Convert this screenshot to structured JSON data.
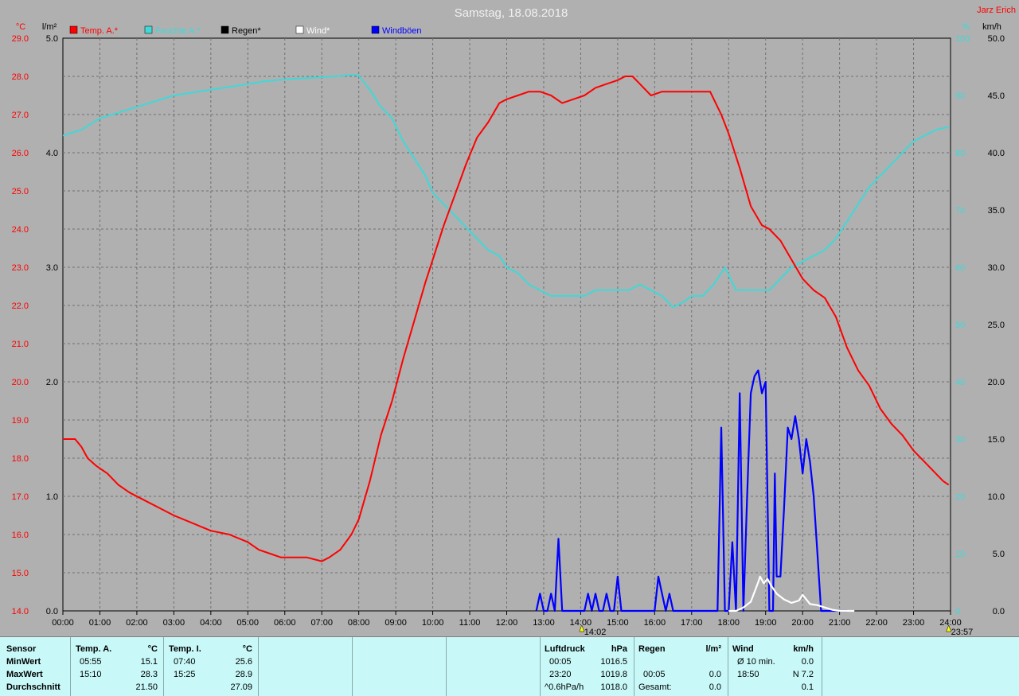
{
  "title": "Samstag, 18.08.2018",
  "author": "Jarz Erich",
  "colors": {
    "background": "#b0b0b0",
    "temp": "#ff0000",
    "humidity": "#40d8d8",
    "rain": "#000000",
    "wind": "#ffffff",
    "gusts": "#0000ff",
    "panel": "#c8f8f8"
  },
  "chart_data": {
    "type": "line",
    "axes": {
      "left_temp": {
        "unit": "°C",
        "range": [
          14.0,
          29.0
        ],
        "ticks": [
          "14.0",
          "15.0",
          "16.0",
          "17.0",
          "18.0",
          "19.0",
          "20.0",
          "21.0",
          "22.0",
          "23.0",
          "24.0",
          "25.0",
          "26.0",
          "27.0",
          "28.0",
          "29.0"
        ]
      },
      "left_rain": {
        "unit": "l/m²",
        "range": [
          0.0,
          5.0
        ],
        "ticks": [
          "0.0",
          "1.0",
          "2.0",
          "3.0",
          "4.0",
          "5.0"
        ]
      },
      "right_humidity": {
        "unit": "%",
        "range": [
          0,
          100
        ],
        "ticks": [
          "0",
          "10",
          "20",
          "30",
          "40",
          "50",
          "60",
          "70",
          "80",
          "90",
          "100"
        ]
      },
      "right_wind": {
        "unit": "km/h",
        "range": [
          0.0,
          50.0
        ],
        "ticks": [
          "0.0",
          "5.0",
          "10.0",
          "15.0",
          "20.0",
          "25.0",
          "30.0",
          "35.0",
          "40.0",
          "45.0",
          "50.0"
        ]
      },
      "x": {
        "range": [
          0,
          24
        ],
        "ticks": [
          "00:00",
          "01:00",
          "02:00",
          "03:00",
          "04:00",
          "05:00",
          "06:00",
          "07:00",
          "08:00",
          "09:00",
          "10:00",
          "11:00",
          "12:00",
          "13:00",
          "14:00",
          "15:00",
          "16:00",
          "17:00",
          "18:00",
          "19:00",
          "20:00",
          "21:00",
          "22:00",
          "23:00",
          "24:00"
        ]
      }
    },
    "grid": true,
    "legend_position": "top-left",
    "markers": [
      {
        "label": "14:02",
        "x": 14.03
      },
      {
        "label": "23:57",
        "x": 23.95
      }
    ],
    "series": [
      {
        "name": "Temp. A.*",
        "axis": "left_temp",
        "color": "#ff0000",
        "x": [
          0,
          0.33,
          0.5,
          0.67,
          0.9,
          1.2,
          1.5,
          1.8,
          2.2,
          2.6,
          3,
          3.5,
          4,
          4.5,
          5,
          5.3,
          5.6,
          5.9,
          6.2,
          6.6,
          7,
          7.2,
          7.5,
          7.8,
          8,
          8.3,
          8.6,
          8.9,
          9.2,
          9.5,
          9.8,
          10,
          10.3,
          10.6,
          10.9,
          11.2,
          11.5,
          11.8,
          12,
          12.3,
          12.6,
          12.9,
          13.2,
          13.5,
          13.8,
          14.1,
          14.4,
          14.7,
          15,
          15.2,
          15.4,
          15.6,
          15.9,
          16.2,
          16.5,
          16.8,
          17,
          17.2,
          17.5,
          17.8,
          18,
          18.3,
          18.6,
          18.9,
          19.1,
          19.4,
          19.7,
          20,
          20.3,
          20.6,
          20.9,
          21.2,
          21.5,
          21.8,
          22.1,
          22.4,
          22.7,
          23,
          23.3,
          23.6,
          23.8,
          23.95
        ],
        "y": [
          18.5,
          18.5,
          18.3,
          18.0,
          17.8,
          17.6,
          17.3,
          17.1,
          16.9,
          16.7,
          16.5,
          16.3,
          16.1,
          16.0,
          15.8,
          15.6,
          15.5,
          15.4,
          15.4,
          15.4,
          15.3,
          15.4,
          15.6,
          16.0,
          16.4,
          17.4,
          18.6,
          19.5,
          20.6,
          21.6,
          22.6,
          23.2,
          24.1,
          24.9,
          25.7,
          26.4,
          26.8,
          27.3,
          27.4,
          27.5,
          27.6,
          27.6,
          27.5,
          27.3,
          27.4,
          27.5,
          27.7,
          27.8,
          27.9,
          28.0,
          28.0,
          27.8,
          27.5,
          27.6,
          27.6,
          27.6,
          27.6,
          27.6,
          27.6,
          27.0,
          26.5,
          25.6,
          24.6,
          24.1,
          24.0,
          23.7,
          23.2,
          22.7,
          22.4,
          22.2,
          21.7,
          20.9,
          20.3,
          19.9,
          19.3,
          18.9,
          18.6,
          18.2,
          17.9,
          17.6,
          17.4,
          17.3
        ]
      },
      {
        "name": "Feuchte A.*",
        "axis": "right_humidity",
        "color": "#40d8d8",
        "x": [
          0,
          0.5,
          1,
          1.5,
          2,
          2.5,
          3,
          3.5,
          4,
          4.5,
          5,
          5.5,
          6,
          6.5,
          7,
          7.5,
          7.8,
          8,
          8.3,
          8.6,
          8.9,
          9.2,
          9.5,
          9.8,
          10,
          10.3,
          10.6,
          10.9,
          11.2,
          11.5,
          11.8,
          12,
          12.3,
          12.6,
          12.9,
          13.2,
          13.5,
          13.8,
          14.1,
          14.4,
          14.7,
          15,
          15.3,
          15.6,
          15.9,
          16.2,
          16.5,
          16.8,
          17,
          17.3,
          17.6,
          17.9,
          18.2,
          18.5,
          18.8,
          19.1,
          19.4,
          19.7,
          20,
          20.3,
          20.6,
          20.9,
          21.2,
          21.5,
          21.8,
          22.1,
          22.4,
          22.7,
          23,
          23.3,
          23.6,
          23.95
        ],
        "y": [
          83,
          84,
          86,
          87,
          88,
          89,
          90,
          90.5,
          91,
          91.5,
          92,
          92.5,
          92.8,
          93,
          93.2,
          93.4,
          93.6,
          93.5,
          91,
          88,
          86,
          82,
          79,
          76,
          73,
          71,
          69,
          67,
          65,
          63,
          62,
          60,
          59,
          57,
          56,
          55,
          55,
          55,
          55,
          56,
          56,
          56,
          56,
          57,
          56,
          55,
          53,
          54,
          55,
          55,
          57,
          60,
          56,
          56,
          56,
          56,
          58,
          60,
          61,
          62,
          63,
          65,
          68,
          71,
          74,
          76,
          78,
          80,
          82,
          83,
          84,
          84.5
        ]
      },
      {
        "name": "Regen*",
        "axis": "left_rain",
        "color": "#000000",
        "x": [],
        "y": []
      },
      {
        "name": "Wind*",
        "axis": "right_wind",
        "color": "#ffffff",
        "x": [
          18,
          18.2,
          18.4,
          18.6,
          18.8,
          18.85,
          18.95,
          19.05,
          19.15,
          19.3,
          19.5,
          19.7,
          19.9,
          20,
          20.1,
          20.2,
          20.4,
          20.6,
          20.8,
          21,
          21.2,
          21.4
        ],
        "y": [
          0,
          0,
          0.3,
          0.8,
          2.5,
          3.0,
          2.4,
          2.8,
          2.2,
          1.5,
          1.0,
          0.7,
          0.9,
          1.4,
          1.0,
          0.6,
          0.5,
          0.3,
          0.1,
          0,
          0,
          0
        ]
      },
      {
        "name": "Windböen",
        "axis": "right_wind",
        "color": "#0000ff",
        "x": [
          12.8,
          12.9,
          13.0,
          13.1,
          13.2,
          13.3,
          13.4,
          13.5,
          13.6,
          13.7,
          14.0,
          14.1,
          14.2,
          14.3,
          14.4,
          14.5,
          14.6,
          14.7,
          14.8,
          14.9,
          15.0,
          15.1,
          15.2,
          15.3,
          15.4,
          15.5,
          16.0,
          16.1,
          16.2,
          16.3,
          16.4,
          16.5,
          16.6,
          16.7,
          17.7,
          17.8,
          17.9,
          18.0,
          18.1,
          18.2,
          18.3,
          18.4,
          18.5,
          18.6,
          18.7,
          18.8,
          18.9,
          19.0,
          19.1,
          19.2,
          19.25,
          19.3,
          19.4,
          19.5,
          19.6,
          19.7,
          19.8,
          19.9,
          20.0,
          20.1,
          20.2,
          20.3,
          20.4,
          20.5,
          20.6,
          20.7,
          20.8,
          21.0,
          21.2
        ],
        "y": [
          0,
          1.5,
          0,
          0,
          1.5,
          0,
          6.3,
          0,
          0,
          0,
          0,
          0,
          1.5,
          0,
          1.5,
          0,
          0,
          1.5,
          0,
          0,
          3.0,
          0,
          0,
          0,
          0,
          0,
          0,
          3.0,
          1.5,
          0,
          1.5,
          0,
          0,
          0,
          0,
          16,
          0,
          0,
          6,
          0,
          19,
          0,
          10,
          19,
          20.5,
          21,
          19,
          20,
          0,
          0,
          12,
          3,
          3,
          9,
          16,
          15,
          17,
          15,
          12,
          15,
          13,
          10,
          5,
          0,
          0,
          0,
          0,
          0,
          0
        ]
      }
    ]
  },
  "stats": {
    "headers": {
      "sensor": "Sensor",
      "temp_a": "Temp. A.",
      "temp_a_unit": "°C",
      "temp_i": "Temp. I.",
      "temp_i_unit": "°C",
      "pressure": "Luftdruck",
      "pressure_unit": "hPa",
      "rain": "Regen",
      "rain_unit": "l/m²",
      "wind": "Wind",
      "wind_unit": "km/h"
    },
    "rows": {
      "min": "MinWert",
      "max": "MaxWert",
      "avg": "Durchschnitt"
    },
    "temp_a": {
      "min_time": "05:55",
      "min_val": "15.1",
      "max_time": "15:10",
      "max_val": "28.3",
      "avg": "21.50"
    },
    "temp_i": {
      "min_time": "07:40",
      "min_val": "25.6",
      "max_time": "15:25",
      "max_val": "28.9",
      "avg": "27.09"
    },
    "pressure": {
      "min_time": "00:05",
      "min_val": "1016.5",
      "max_time": "23:20",
      "max_val": "1019.8",
      "trend_label": "^0.6hPa/h",
      "trend_val": "1018.0"
    },
    "rain": {
      "max_time": "00:05",
      "max_val": "0.0",
      "total_label": "Gesamt:",
      "total_val": "0.0"
    },
    "wind": {
      "avg_label": "Ø 10 min.",
      "avg_val": "0.0",
      "max_time": "18:50",
      "max_val": "N 7.2",
      "last_val": "0.1"
    }
  }
}
